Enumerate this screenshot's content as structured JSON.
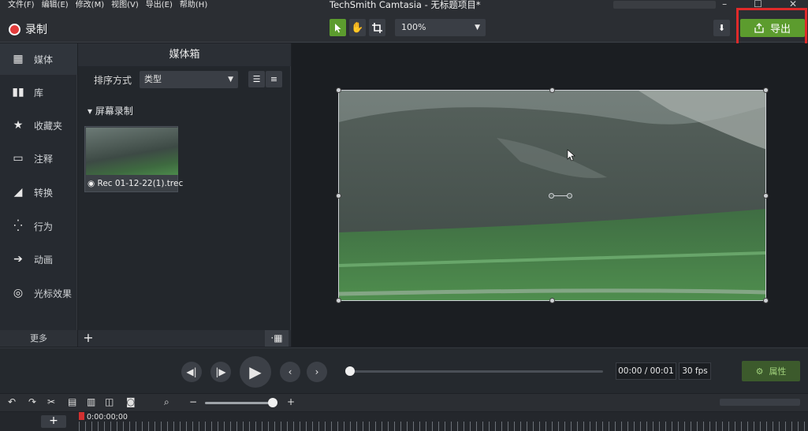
{
  "app": {
    "title": "TechSmith Camtasia - 无标题项目*",
    "menu": [
      "文件(F)",
      "编辑(E)",
      "修改(M)",
      "视图(V)",
      "导出(E)",
      "帮助(H)"
    ],
    "window_controls": [
      "–",
      "☐",
      "✕"
    ]
  },
  "toolbar": {
    "record_label": "录制",
    "zoom_value": "100%",
    "export_label": "导出"
  },
  "sidebar": {
    "items": [
      {
        "label": "媒体",
        "icon": "film-icon"
      },
      {
        "label": "库",
        "icon": "library-icon"
      },
      {
        "label": "收藏夹",
        "icon": "star-icon"
      },
      {
        "label": "注释",
        "icon": "annotation-icon"
      },
      {
        "label": "转换",
        "icon": "transition-icon"
      },
      {
        "label": "行为",
        "icon": "behavior-icon"
      },
      {
        "label": "动画",
        "icon": "animation-icon"
      },
      {
        "label": "光标效果",
        "icon": "cursor-effect-icon"
      }
    ],
    "more_label": "更多"
  },
  "media_bin": {
    "title": "媒体箱",
    "sort_label": "排序方式",
    "sort_value": "类型",
    "group_header": "屏幕录制",
    "clip_name": "Rec 01-12-22(1).trec"
  },
  "playback": {
    "timecode": "00:00 / 00:01",
    "fps": "30 fps",
    "properties_label": "属性",
    "progress": 0
  },
  "timeline": {
    "playhead_time": "0:00:00;00"
  },
  "colors": {
    "accent": "#5c9c2e",
    "record": "#e33b3b",
    "highlight": "#e02a2a"
  }
}
